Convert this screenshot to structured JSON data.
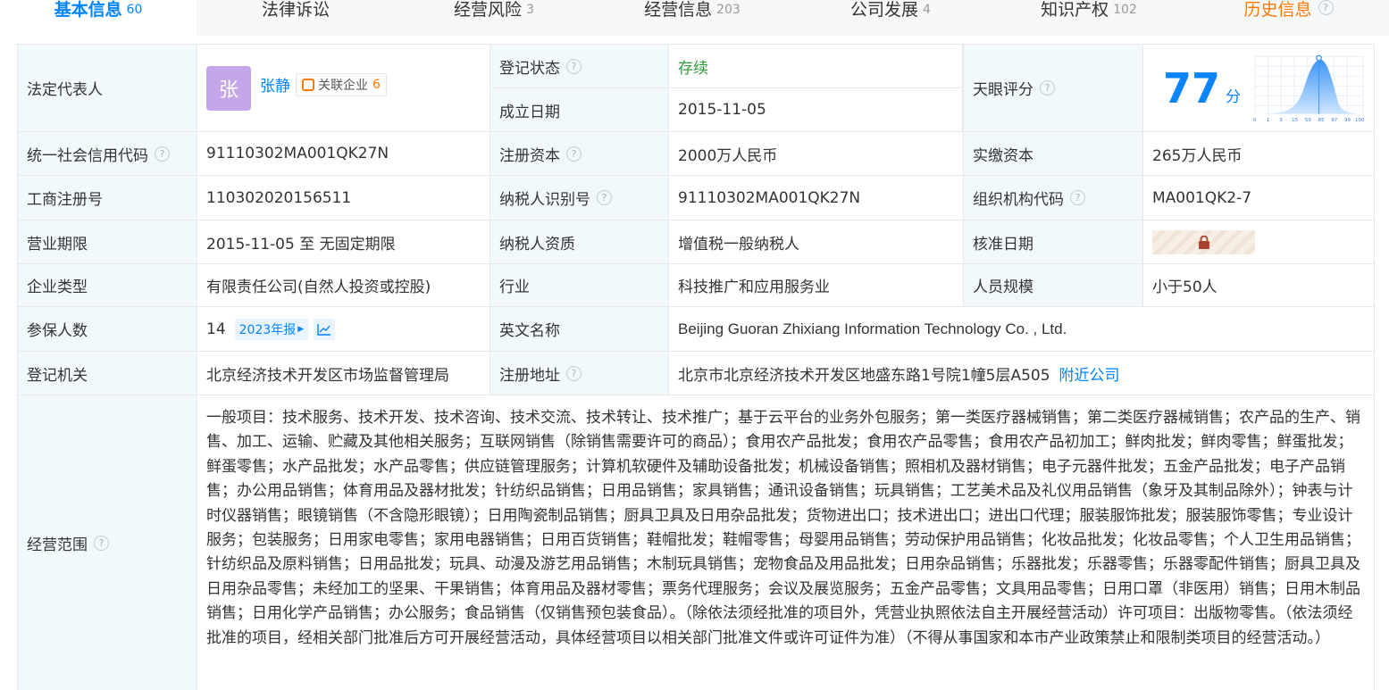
{
  "tabs": [
    {
      "label": "基本信息",
      "count": "60"
    },
    {
      "label": "法律诉讼",
      "count": ""
    },
    {
      "label": "经营风险",
      "count": "3"
    },
    {
      "label": "经营信息",
      "count": "203"
    },
    {
      "label": "公司发展",
      "count": "4"
    },
    {
      "label": "知识产权",
      "count": "102"
    },
    {
      "label": "历史信息",
      "count": ""
    }
  ],
  "legal_rep": {
    "label": "法定代表人",
    "avatar_char": "张",
    "name": "张静",
    "related_label": "关联企业",
    "related_count": "6"
  },
  "reg_status": {
    "label": "登记状态",
    "value": "存续"
  },
  "found_date": {
    "label": "成立日期",
    "value": "2015-11-05"
  },
  "tianyan": {
    "label": "天眼评分",
    "score": "77",
    "unit": "分",
    "axis_ticks": [
      "0",
      "1",
      "3",
      "15",
      "50",
      "85",
      "97",
      "99",
      "100"
    ]
  },
  "credit_code": {
    "label": "统一社会信用代码",
    "value": "91110302MA001QK27N"
  },
  "reg_capital": {
    "label": "注册资本",
    "value": "2000万人民币"
  },
  "paid_capital": {
    "label": "实缴资本",
    "value": "265万人民币"
  },
  "reg_no": {
    "label": "工商注册号",
    "value": "110302020156511"
  },
  "taxpayer_id": {
    "label": "纳税人识别号",
    "value": "91110302MA001QK27N"
  },
  "org_code": {
    "label": "组织机构代码",
    "value": "MA001QK2-7"
  },
  "term": {
    "label": "营业期限",
    "value": "2015-11-05 至 无固定期限"
  },
  "tax_qual": {
    "label": "纳税人资质",
    "value": "增值税一般纳税人"
  },
  "approve_date": {
    "label": "核准日期"
  },
  "company_type": {
    "label": "企业类型",
    "value": "有限责任公司(自然人投资或控股)"
  },
  "industry": {
    "label": "行业",
    "value": "科技推广和应用服务业"
  },
  "staff_size": {
    "label": "人员规模",
    "value": "小于50人"
  },
  "insured": {
    "label": "参保人数",
    "value": "14",
    "year_btn": "2023年报"
  },
  "english_name": {
    "label": "英文名称",
    "value": "Beijing Guoran Zhixiang Information Technology Co. , Ltd."
  },
  "reg_authority": {
    "label": "登记机关",
    "value": "北京经济技术开发区市场监督管理局"
  },
  "reg_address": {
    "label": "注册地址",
    "value": "北京市北京经济技术开发区地盛东路1号院1幢5层A505",
    "nearby": "附近公司"
  },
  "scope": {
    "label": "经营范围",
    "value": "一般项目：技术服务、技术开发、技术咨询、技术交流、技术转让、技术推广；基于云平台的业务外包服务；第一类医疗器械销售；第二类医疗器械销售；农产品的生产、销售、加工、运输、贮藏及其他相关服务；互联网销售（除销售需要许可的商品）；食用农产品批发；食用农产品零售；食用农产品初加工；鲜肉批发；鲜肉零售；鲜蛋批发；鲜蛋零售；水产品批发；水产品零售；供应链管理服务；计算机软硬件及辅助设备批发；机械设备销售；照相机及器材销售；电子元器件批发；五金产品批发；电子产品销售；办公用品销售；体育用品及器材批发；针纺织品销售；日用品销售；家具销售；通讯设备销售；玩具销售；工艺美术品及礼仪用品销售（象牙及其制品除外）；钟表与计时仪器销售；眼镜销售（不含隐形眼镜）；日用陶瓷制品销售；厨具卫具及日用杂品批发；货物进出口；技术进出口；进出口代理；服装服饰批发；服装服饰零售；专业设计服务；包装服务；日用家电零售；家用电器销售；日用百货销售；鞋帽批发；鞋帽零售；母婴用品销售；劳动保护用品销售；化妆品批发；化妆品零售；个人卫生用品销售；针纺织品及原料销售；日用品批发；玩具、动漫及游艺用品销售；木制玩具销售；宠物食品及用品批发；日用杂品销售；乐器批发；乐器零售；乐器零配件销售；厨具卫具及日用杂品零售；未经加工的坚果、干果销售；体育用品及器材零售；票务代理服务；会议及展览服务；五金产品零售；文具用品零售；日用口罩（非医用）销售；日用木制品销售；日用化学产品销售；办公服务；食品销售（仅销售预包装食品）。（除依法须经批准的项目外，凭营业执照依法自主开展经营活动）许可项目：出版物零售。（依法须经批准的项目，经相关部门批准后方可开展经营活动，具体经营项目以相关部门批准文件或许可证件为准）（不得从事国家和本市产业政策禁止和限制类项目的经营活动。）"
  },
  "colors": {
    "accent": "#0084ff",
    "label_bg": "#f2f9fc",
    "status_green": "#2e9e3c",
    "history_orange": "#ff7a00"
  }
}
